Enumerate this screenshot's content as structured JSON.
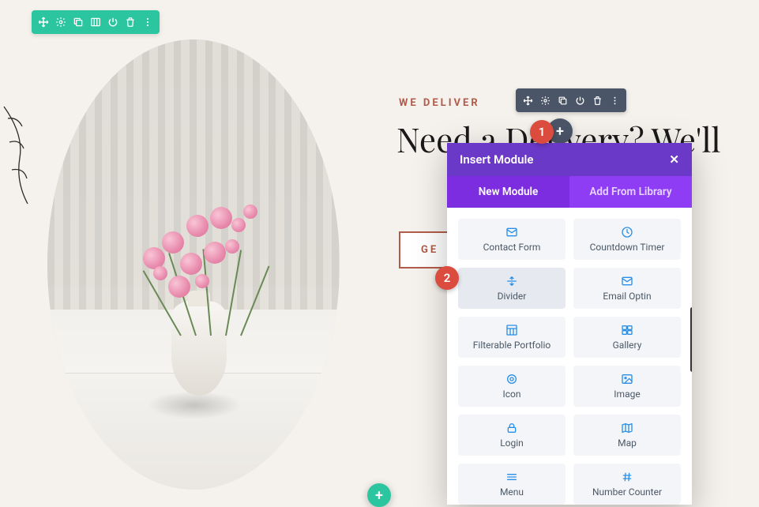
{
  "section_toolbar": {
    "icons": [
      "move",
      "gear",
      "duplicate",
      "columns",
      "power",
      "trash",
      "more"
    ]
  },
  "module_toolbar": {
    "icons": [
      "move",
      "gear",
      "duplicate",
      "power",
      "trash",
      "more"
    ]
  },
  "page": {
    "eyebrow": "WE DELIVER",
    "headline": "Need a Delivery? We'll",
    "cta": "GE"
  },
  "steps": {
    "one": "1",
    "two": "2"
  },
  "modal": {
    "title": "Insert Module",
    "tabs": {
      "new": "New Module",
      "library": "Add From Library"
    },
    "modules": [
      {
        "label": "Contact Form",
        "icon": "mail"
      },
      {
        "label": "Countdown Timer",
        "icon": "clock"
      },
      {
        "label": "Divider",
        "icon": "divider",
        "highlight": true
      },
      {
        "label": "Email Optin",
        "icon": "mail"
      },
      {
        "label": "Filterable Portfolio",
        "icon": "grid"
      },
      {
        "label": "Gallery",
        "icon": "gallery"
      },
      {
        "label": "Icon",
        "icon": "target"
      },
      {
        "label": "Image",
        "icon": "image"
      },
      {
        "label": "Login",
        "icon": "lock"
      },
      {
        "label": "Map",
        "icon": "map"
      },
      {
        "label": "Menu",
        "icon": "menu"
      },
      {
        "label": "Number Counter",
        "icon": "hash"
      }
    ]
  }
}
